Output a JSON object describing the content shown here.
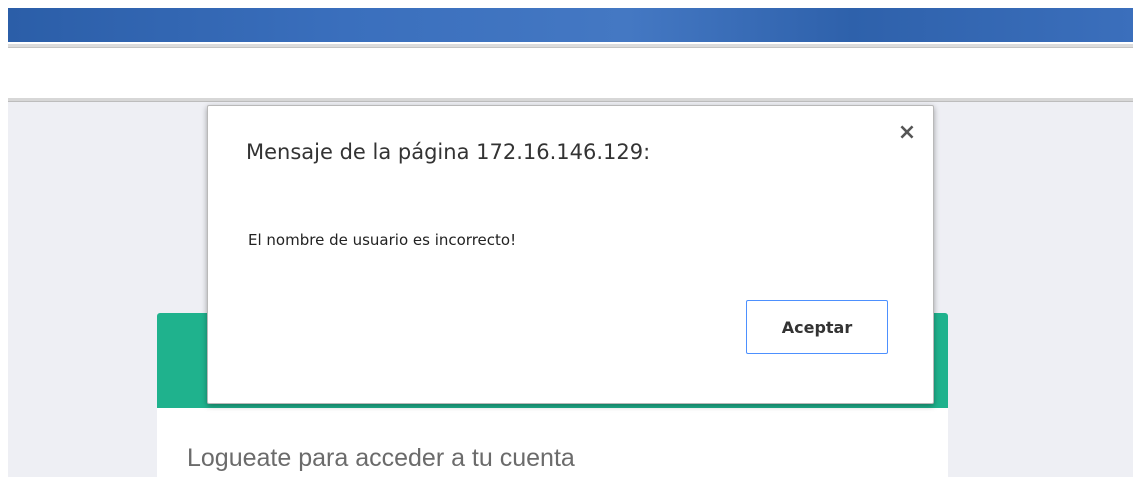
{
  "dialog": {
    "title": "Mensaje de la página 172.16.146.129:",
    "message": "El nombre de usuario es incorrecto!",
    "close_icon": "close-icon",
    "close_glyph": "×",
    "ok_label": "Aceptar"
  },
  "page": {
    "login_subtitle": "Logueate para acceder a tu cuenta"
  },
  "colors": {
    "browser_bar": "#3a6fbd",
    "page_background": "#eeeff4",
    "card_header": "#1fb28d",
    "focus_border": "#4d90fe"
  }
}
